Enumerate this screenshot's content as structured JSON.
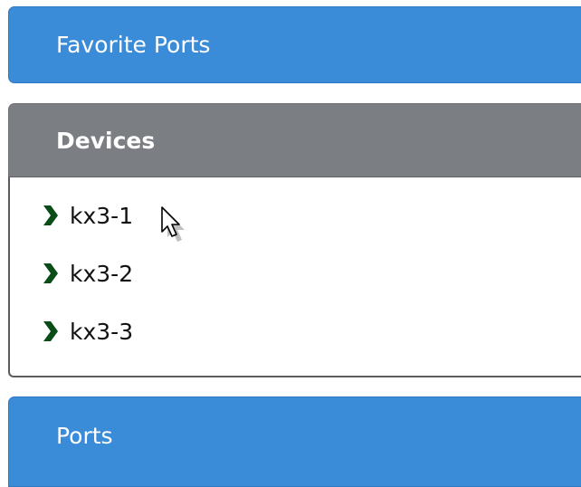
{
  "panels": {
    "favorite_ports": {
      "label": "Favorite Ports"
    },
    "devices": {
      "label": "Devices",
      "items": [
        {
          "label": "kx3-1"
        },
        {
          "label": "kx3-2"
        },
        {
          "label": "kx3-3"
        }
      ]
    },
    "ports": {
      "label": "Ports"
    }
  },
  "colors": {
    "accent_blue": "#3a8bd8",
    "devices_header_gray": "#7b7e83",
    "chevron_green": "#0b4d18"
  },
  "icons": {
    "device_bullet": "chevron-right-icon",
    "pointer": "mouse-cursor-icon"
  }
}
